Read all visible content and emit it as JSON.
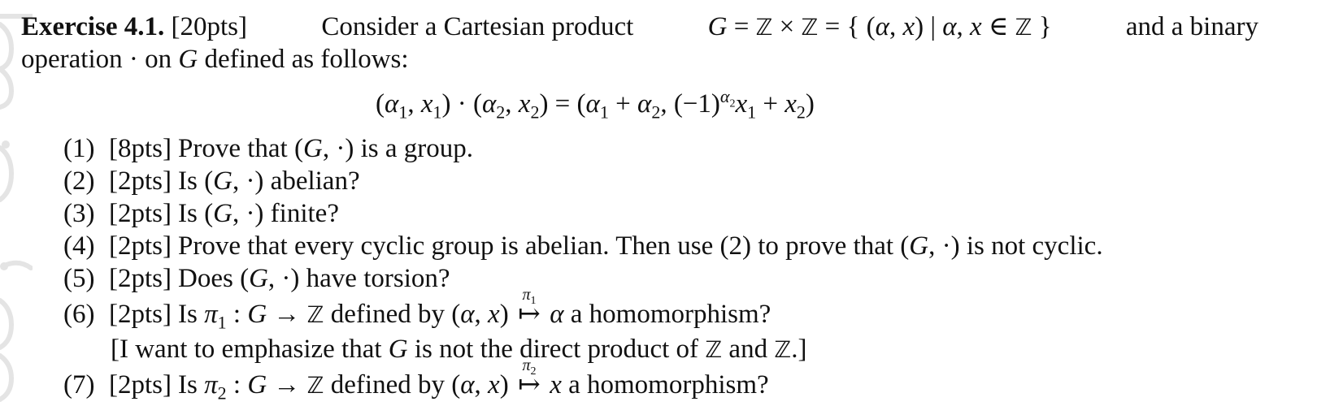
{
  "exercise": {
    "label": "Exercise 4.1.",
    "points": "[20pts]",
    "intro_line1_text": "Consider a Cartesian product",
    "set_definition": "G = ℤ × ℤ = { (α, x) | α, x ∈ ℤ }",
    "intro_line1_tail": "and a binary",
    "intro_line2": "operation · on G defined as follows:",
    "operation_formula": "(α₁, x₁) · (α₂, x₂) = (α₁ + α₂, (−1)^α₂ x₁ + x₂)"
  },
  "items": [
    {
      "num": "(1)",
      "points": "[8pts]",
      "text": "Prove that (G, ·) is a group."
    },
    {
      "num": "(2)",
      "points": "[2pts]",
      "text": "Is (G, ·) abelian?"
    },
    {
      "num": "(3)",
      "points": "[2pts]",
      "text": "Is (G, ·) finite?"
    },
    {
      "num": "(4)",
      "points": "[2pts]",
      "text": "Prove that every cyclic group is abelian. Then use (2) to prove that (G, ·) is not cyclic."
    },
    {
      "num": "(5)",
      "points": "[2pts]",
      "text": "Does (G, ·) have torsion?"
    },
    {
      "num": "(6)",
      "points": "[2pts]",
      "text": "Is π₁ : G → ℤ defined by (α, x) ↦ α a homomorphism?",
      "map_label": "π₁",
      "note": "[I want to emphasize that G is not the direct product of ℤ and ℤ.]"
    },
    {
      "num": "(7)",
      "points": "[2pts]",
      "text": "Is π₂ : G → ℤ defined by (α, x) ↦ x a homomorphism?",
      "map_label": "π₂"
    }
  ],
  "strings": {
    "consider": "Consider a Cartesian product",
    "and_binary": "and a binary",
    "operation": "operation · on",
    "defined_as_follows": "defined as follows:",
    "prove_group": "Prove that",
    "is_a_group": "is a group.",
    "is": "Is",
    "abelian_q": "abelian?",
    "finite_q": "finite?",
    "prove_cyclic": "Prove that every cyclic group is abelian. Then use (2) to prove that",
    "is_not_cyclic": "is not cyclic.",
    "does": "Does",
    "have_torsion": "have torsion?",
    "defined_by": "defined by",
    "a_homomorphism": "a homomorphism?",
    "note_prefix": "[I want to emphasize that",
    "note_mid": "is not the direct product of",
    "note_and": "and",
    "note_end": ".]"
  }
}
